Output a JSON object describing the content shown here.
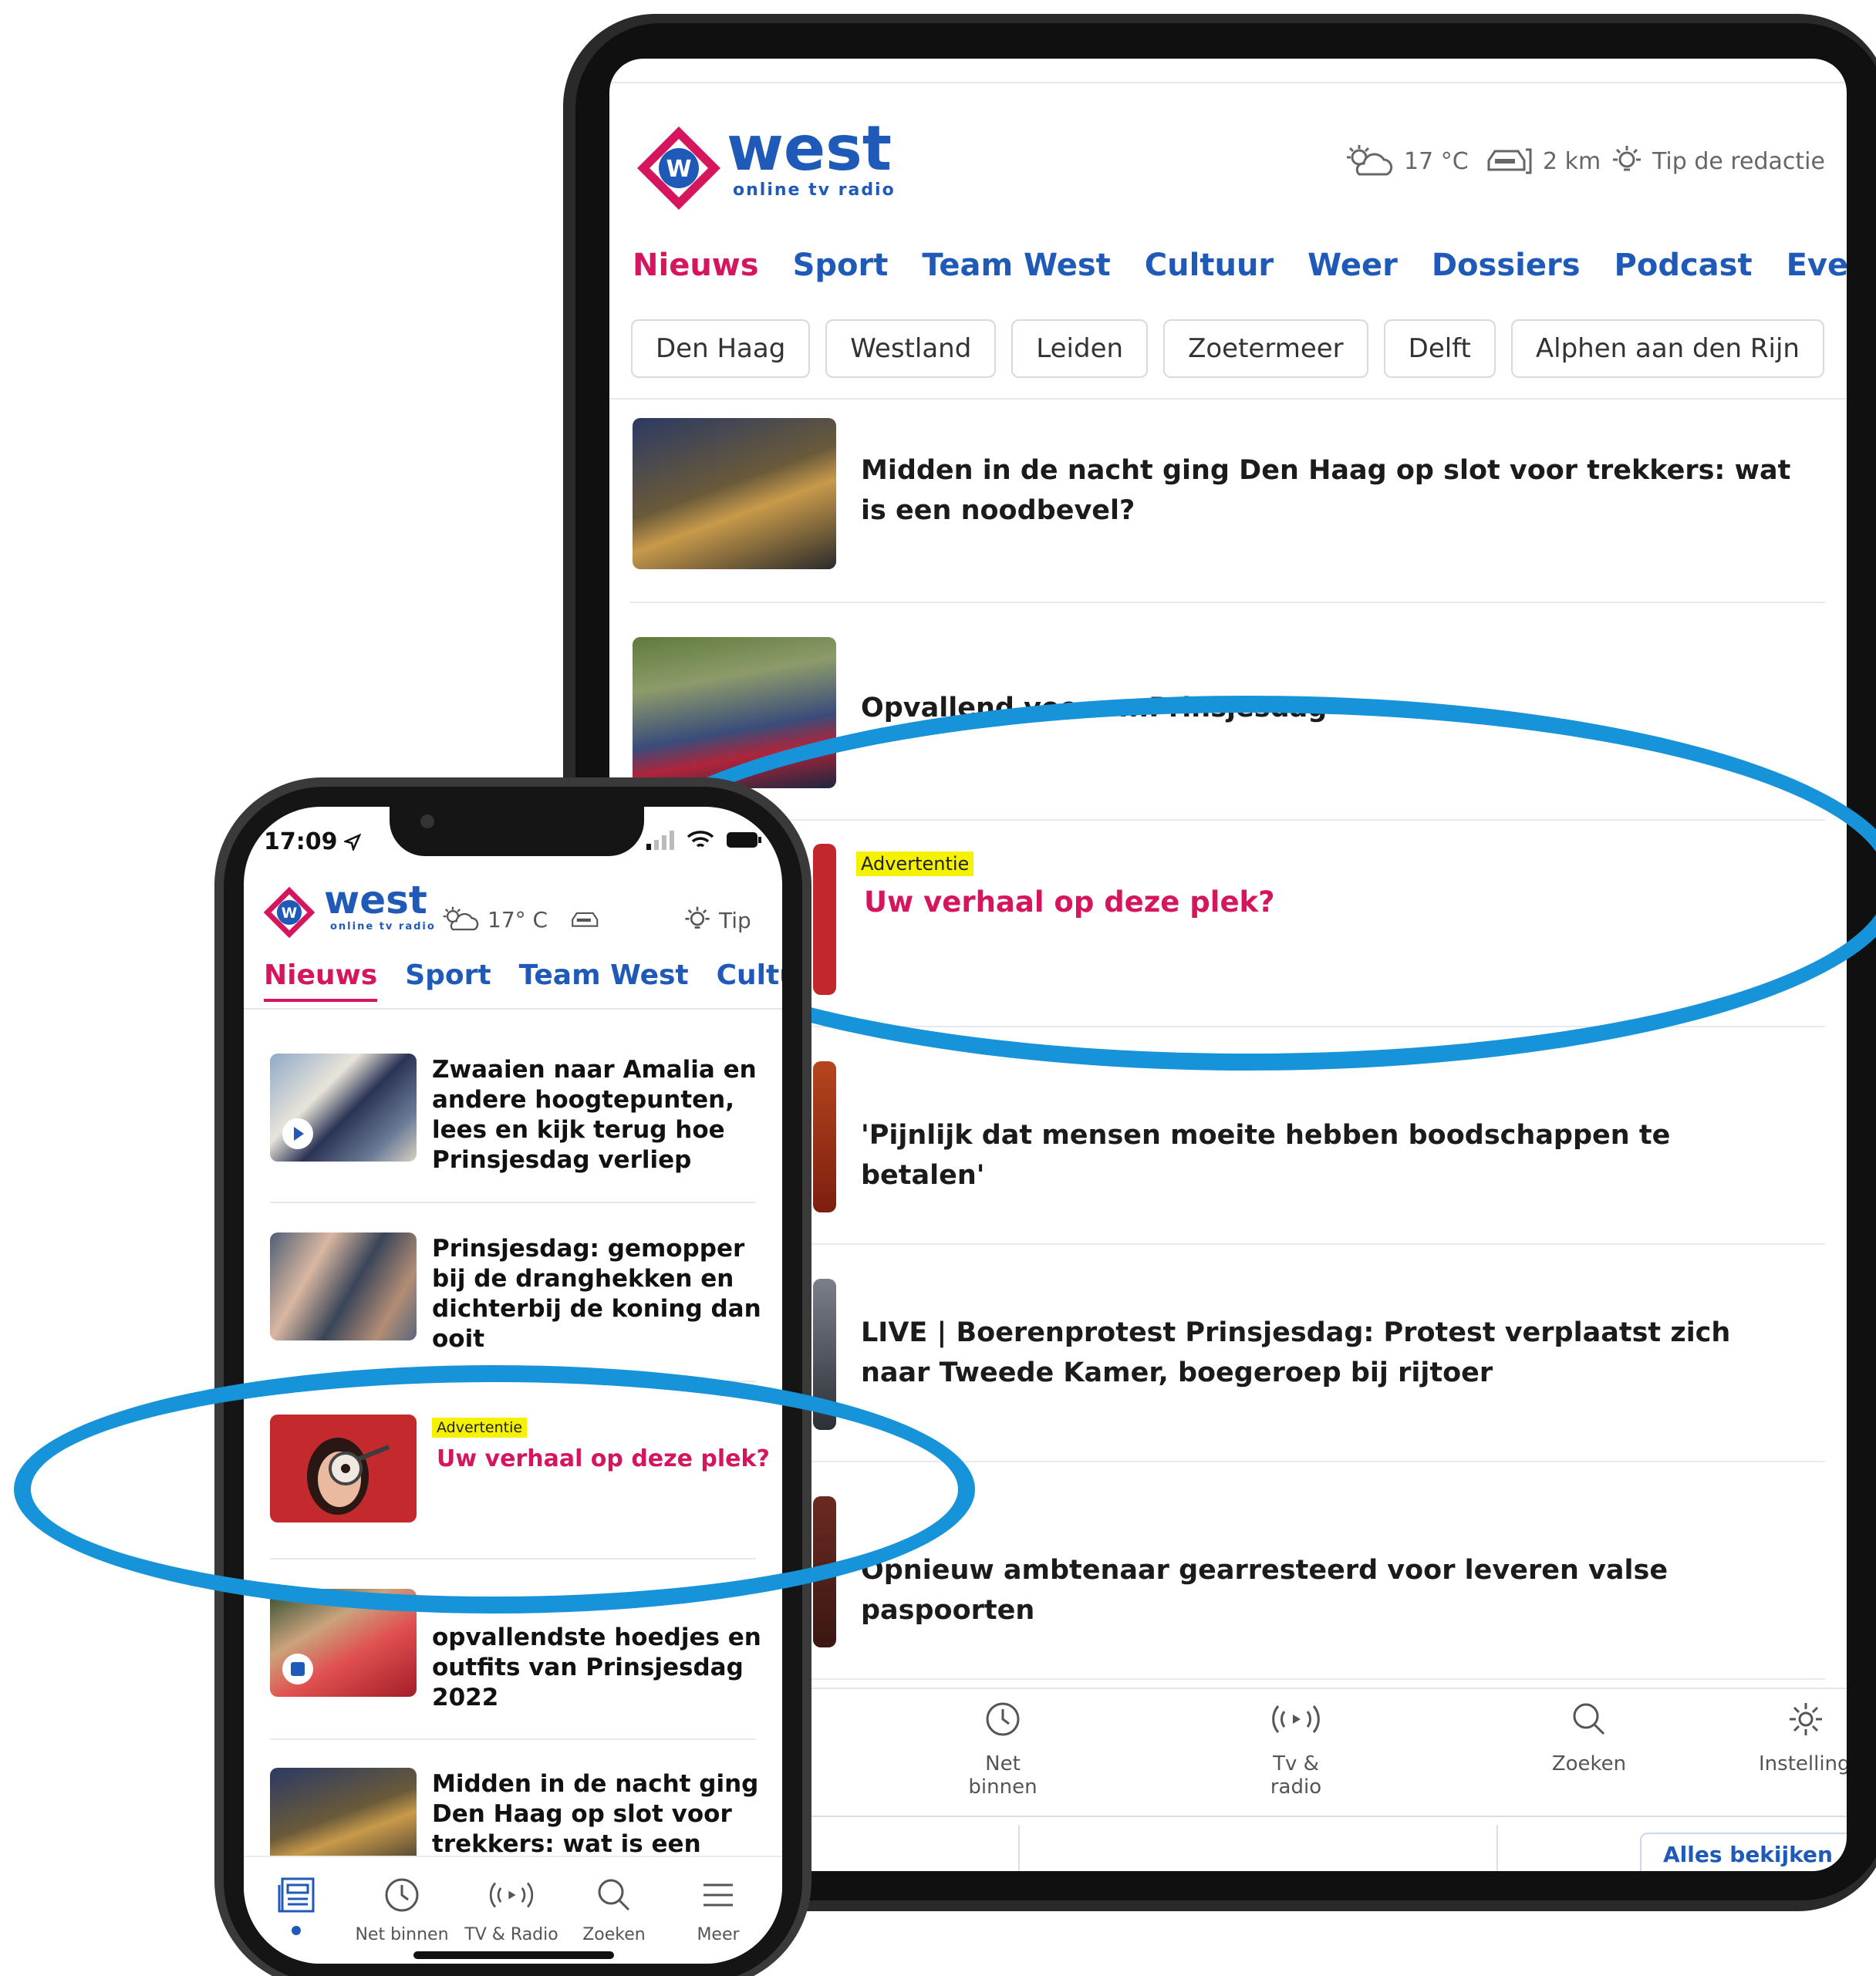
{
  "tablet": {
    "logo": {
      "name": "west",
      "sub": "online   tv   radio"
    },
    "weather": "17 °C",
    "traffic": "2 km",
    "tip": "Tip de redactie",
    "tabs": [
      "Nieuws",
      "Sport",
      "Team West",
      "Cultuur",
      "Weer",
      "Dossiers",
      "Podcast",
      "Eveneme"
    ],
    "chips": [
      "Den Haag",
      "Westland",
      "Leiden",
      "Zoetermeer",
      "Delft",
      "Alphen aan den Rijn"
    ],
    "articles": [
      {
        "title": "Midden in de nacht ging Den Haag op slot voor trekkers: wat is een noodbevel?"
      },
      {
        "title": "Opvallend vee...                   ...Prinsjesdag"
      },
      {
        "badge": "Advertentie",
        "title": "Uw verhaal op deze plek?"
      },
      {
        "title": "'Pijnlijk dat mensen moeite hebben boodschappen te betalen'"
      },
      {
        "title": "LIVE | Boerenprotest Prinsjesdag: Protest verplaatst zich naar Tweede Kamer, boegeroep bij rijtoer"
      },
      {
        "title": "Opnieuw ambtenaar gearresteerd voor leveren valse paspoorten"
      }
    ],
    "bottom_nav": [
      "Net binnen",
      "Tv & radio",
      "Zoeken",
      "Instelling"
    ],
    "bottom_link": "Alles bekijken"
  },
  "phone": {
    "time": "17:09",
    "logo": {
      "name": "west",
      "sub": "online  tv  radio"
    },
    "weather": "17° C",
    "tip": "Tip",
    "tabs": [
      "Nieuws",
      "Sport",
      "Team West",
      "Cultu"
    ],
    "articles": [
      {
        "title": "Zwaaien naar Amalia en andere hoogtepunten, lees en kijk terug hoe Prinsjesdag verliep"
      },
      {
        "title": "Prinsjesdag: gemopper bij de dranghekken en dichterbij de koning dan ooit"
      },
      {
        "badge": "Advertentie",
        "title": "Uw verhaal op deze plek?"
      },
      {
        "title": "opvallendste hoedjes en outfits van Prinsjesdag 2022"
      },
      {
        "title": "Midden in de nacht ging Den Haag op slot voor trekkers: wat is een"
      }
    ],
    "bottom_nav": [
      "Net binnen",
      "TV & Radio",
      "Zoeken",
      "Meer"
    ]
  },
  "colors": {
    "brand_blue": "#1f5ab8",
    "brand_pink": "#d6155f",
    "highlight_ring": "#1793d9",
    "ad_badge": "#f5f200"
  }
}
